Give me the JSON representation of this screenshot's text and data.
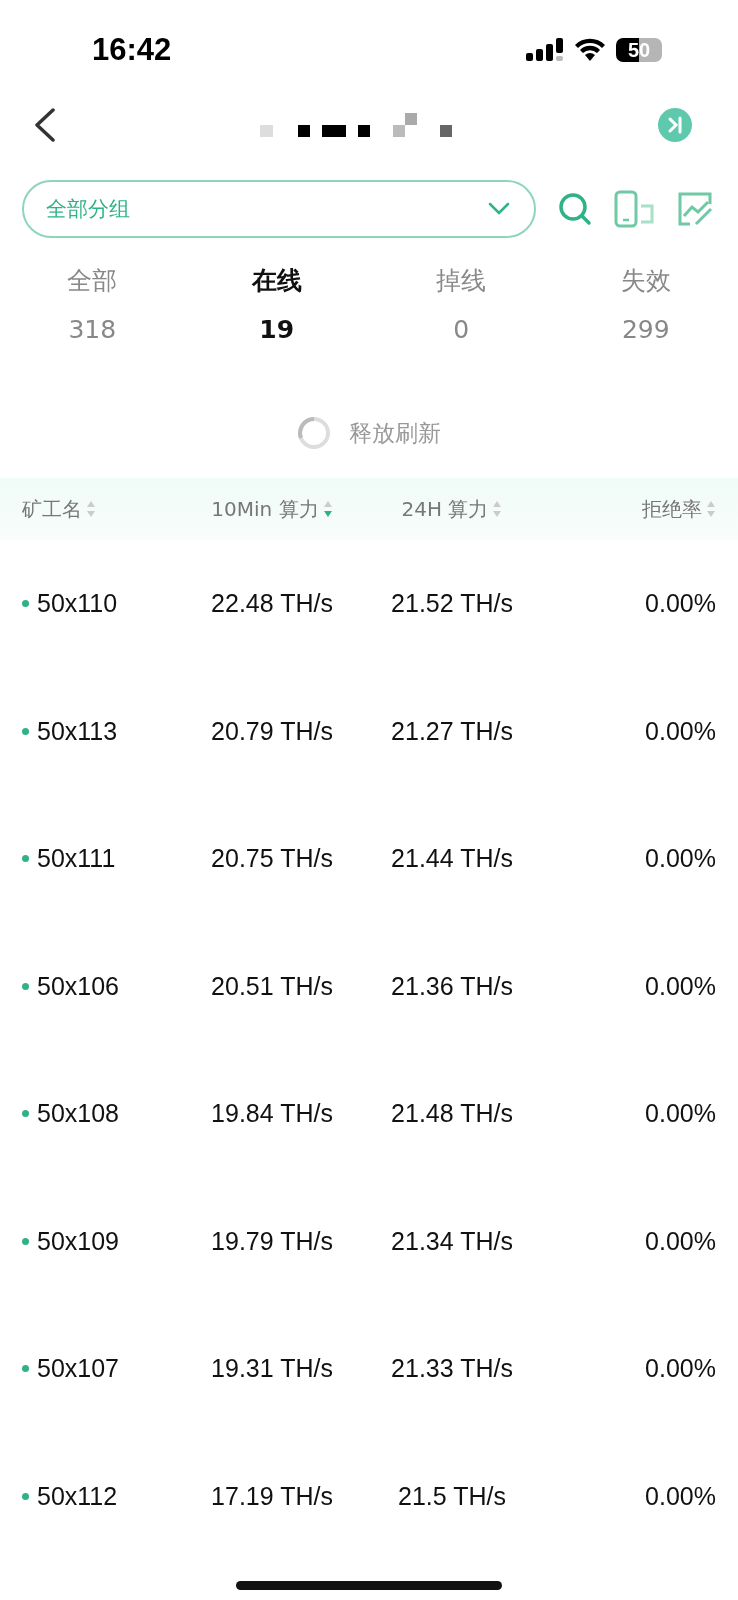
{
  "status_bar": {
    "time": "16:42",
    "battery": "50"
  },
  "group_select": {
    "value": "全部分组"
  },
  "tabs": [
    {
      "label": "全部",
      "count": "318",
      "selected": false
    },
    {
      "label": "在线",
      "count": "19",
      "selected": true
    },
    {
      "label": "掉线",
      "count": "0",
      "selected": false
    },
    {
      "label": "失效",
      "count": "299",
      "selected": false
    }
  ],
  "refresh": {
    "label": "释放刷新"
  },
  "table": {
    "columns": [
      {
        "label": "矿工名",
        "sorted_desc": false
      },
      {
        "label": "10Min 算力",
        "sorted_desc": true
      },
      {
        "label": "24H 算力",
        "sorted_desc": false
      },
      {
        "label": "拒绝率",
        "sorted_desc": false
      }
    ],
    "rows": [
      {
        "name": "50x110",
        "online": true,
        "hash_10min": "22.48 TH/s",
        "hash_24h": "21.52 TH/s",
        "reject_rate": "0.00%"
      },
      {
        "name": "50x113",
        "online": true,
        "hash_10min": "20.79 TH/s",
        "hash_24h": "21.27 TH/s",
        "reject_rate": "0.00%"
      },
      {
        "name": "50x111",
        "online": true,
        "hash_10min": "20.75 TH/s",
        "hash_24h": "21.44 TH/s",
        "reject_rate": "0.00%"
      },
      {
        "name": "50x106",
        "online": true,
        "hash_10min": "20.51 TH/s",
        "hash_24h": "21.36 TH/s",
        "reject_rate": "0.00%"
      },
      {
        "name": "50x108",
        "online": true,
        "hash_10min": "19.84 TH/s",
        "hash_24h": "21.48 TH/s",
        "reject_rate": "0.00%"
      },
      {
        "name": "50x109",
        "online": true,
        "hash_10min": "19.79 TH/s",
        "hash_24h": "21.34 TH/s",
        "reject_rate": "0.00%"
      },
      {
        "name": "50x107",
        "online": true,
        "hash_10min": "19.31 TH/s",
        "hash_24h": "21.33 TH/s",
        "reject_rate": "0.00%"
      },
      {
        "name": "50x112",
        "online": true,
        "hash_10min": "17.19 TH/s",
        "hash_24h": "21.5 TH/s",
        "reject_rate": "0.00%"
      }
    ]
  }
}
